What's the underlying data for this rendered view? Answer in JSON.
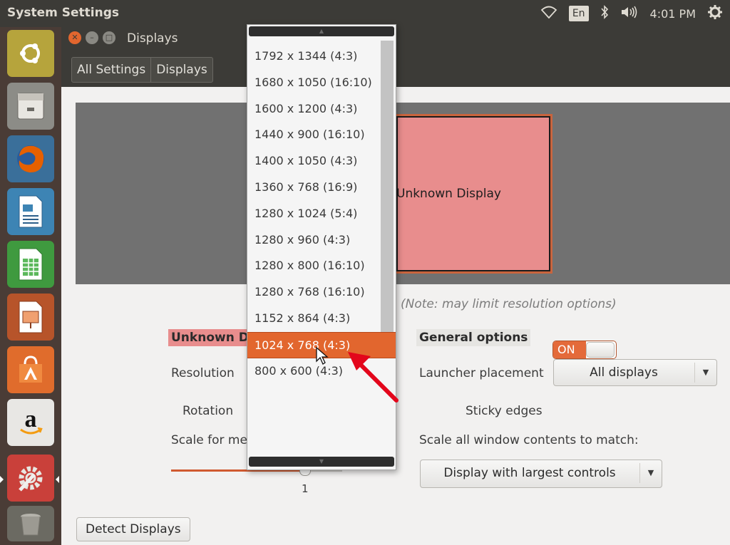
{
  "panel": {
    "app_title": "System Settings",
    "keyboard_layout": "En",
    "clock": "4:01 PM"
  },
  "launcher": {
    "items": [
      "ubuntu-dash",
      "files",
      "firefox",
      "libreoffice-writer",
      "libreoffice-calc",
      "libreoffice-impress",
      "ubuntu-software-center",
      "amazon",
      "system-settings",
      "trash"
    ],
    "active": "system-settings"
  },
  "window": {
    "title": "Displays",
    "breadcrumbs": [
      "All Settings",
      "Displays"
    ]
  },
  "display_preview": {
    "monitor_label": "Unknown Display",
    "note": "(Note: may limit resolution options)"
  },
  "left_section": {
    "heading": "Unknown Di",
    "resolution_label": "Resolution",
    "rotation_label": "Rotation",
    "scale_label": "Scale for me",
    "scale_value": "1"
  },
  "general_options": {
    "heading": "General options",
    "launcher_placement_label": "Launcher placement",
    "launcher_placement_value": "All displays",
    "sticky_edges_label": "Sticky edges",
    "sticky_edges_state": "ON",
    "scale_all_label": "Scale all window contents to match:",
    "scale_all_value": "Display with largest controls"
  },
  "buttons": {
    "detect_displays": "Detect Displays"
  },
  "resolution_menu": {
    "options": [
      "1792 x 1344 (4:3)",
      "1680 x 1050 (16:10)",
      "1600 x 1200 (4:3)",
      "1440 x 900 (16:10)",
      "1400 x 1050 (4:3)",
      "1360 x 768 (16:9)",
      "1280 x 1024 (5:4)",
      "1280 x 960 (4:3)",
      "1280 x 800 (16:10)",
      "1280 x 768 (16:10)",
      "1152 x 864 (4:3)",
      "1024 x 768 (4:3)",
      "800 x 600 (4:3)"
    ],
    "selected_index": 11
  },
  "colors": {
    "accent": "#e2662e",
    "panel": "#3c3b37",
    "launcher": "#4a3c36",
    "monitor": "#e88d8d",
    "annotation_arrow": "#e3061b"
  }
}
